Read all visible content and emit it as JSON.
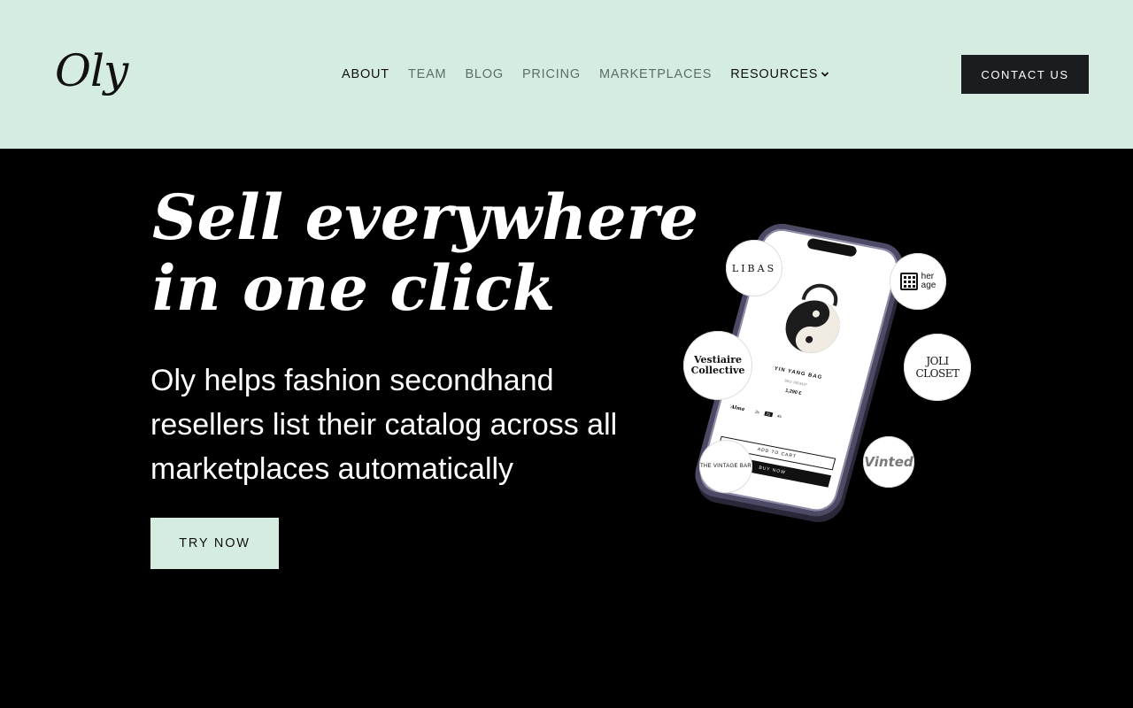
{
  "header": {
    "logo": "Oly",
    "nav": [
      {
        "label": "ABOUT"
      },
      {
        "label": "TEAM"
      },
      {
        "label": "BLOG"
      },
      {
        "label": "PRICING"
      },
      {
        "label": "MARKETPLACES"
      },
      {
        "label": "RESOURCES"
      }
    ],
    "contact_label": "CONTACT US"
  },
  "hero": {
    "title_line1": "Sell everywhere",
    "title_line2": "in one click",
    "subtitle": "Oly helps fashion secondhand resellers list their catalog across all marketplaces automatically",
    "cta_label": "TRY NOW"
  },
  "illustration": {
    "phone": {
      "product_title": "YIN YANG BAG",
      "sku": "SKU: 0623437",
      "price": "1,290 €",
      "size_label": "Alma",
      "sizes": [
        "2s",
        "2s",
        "4s"
      ],
      "add_to_cart": "ADD TO CART",
      "buy_now": "BUY NOW"
    },
    "marketplaces": {
      "libas": "LIBAS",
      "heritage": "her\nage",
      "vestiaire": "Vestiaire Collective",
      "joli_closet": "JOLI CLOSET",
      "vintage_bar": "THE VINTAGE BAR",
      "vinted": "Vinted"
    }
  },
  "colors": {
    "mint": "#d4ede0",
    "dark_button": "#1b1c1f",
    "background": "#000000"
  }
}
